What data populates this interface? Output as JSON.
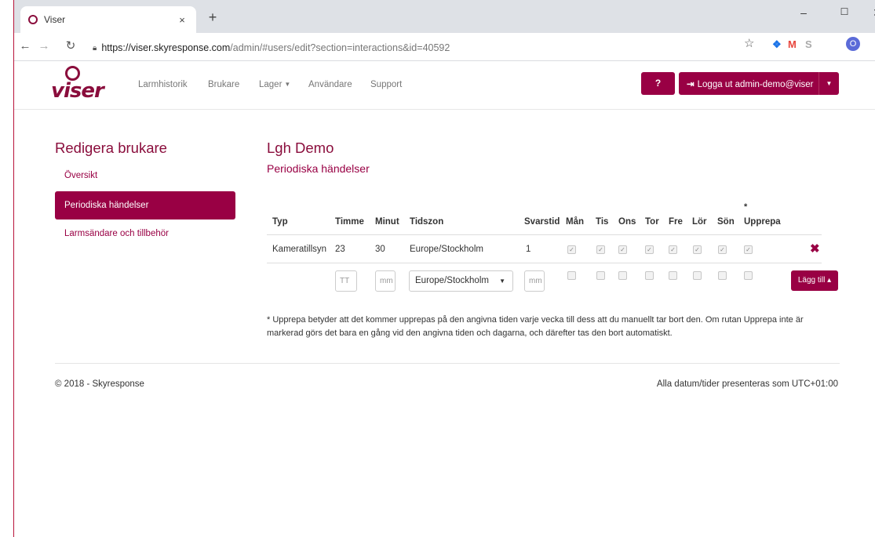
{
  "browser": {
    "tab_title": "Viser",
    "tab_close": "×",
    "new_tab": "+",
    "url_host": "https://viser.skyresponse.com",
    "url_path": "/admin/#users/edit?section=interactions&id=40592",
    "profile_initial": "O",
    "icons": [
      "back-icon",
      "forward-icon",
      "reload-icon",
      "lock-icon",
      "star-icon",
      "minimize-icon",
      "maximize-icon",
      "close-icon"
    ]
  },
  "navbar": {
    "logo_text": "viser",
    "links": {
      "larmhistorik": "Larmhistorik",
      "brukare": "Brukare",
      "lager": "Lager",
      "anvandare": "Användare",
      "support": "Support"
    },
    "help_label": "?",
    "logout_label": "Logga ut admin-demo@viser"
  },
  "sidebar": {
    "title": "Redigera brukare",
    "items": [
      {
        "label": "Översikt",
        "active": false
      },
      {
        "label": "Periodiska händelser",
        "active": true
      },
      {
        "label": "Larmsändare och tillbehör",
        "active": false
      }
    ]
  },
  "main": {
    "title": "Lgh Demo",
    "subtitle": "Periodiska händelser",
    "table": {
      "headers": {
        "typ": "Typ",
        "timme": "Timme",
        "minut": "Minut",
        "tidszon": "Tidszon",
        "svarstid": "Svarstid",
        "man": "Mån",
        "tis": "Tis",
        "ons": "Ons",
        "tor": "Tor",
        "fre": "Fre",
        "lor": "Lör",
        "son": "Sön",
        "upprepa_star": "*",
        "upprepa": "Upprepa"
      },
      "row": {
        "typ": "Kameratillsyn",
        "timme": "23",
        "minut": "30",
        "tidszon": "Europe/Stockholm",
        "svarstid": "1",
        "days_checked": [
          true,
          true,
          true,
          true,
          true,
          true,
          true
        ],
        "upprepa_checked": true
      },
      "new_row": {
        "timme_placeholder": "TT",
        "minut_placeholder": "mm",
        "tidszon_value": "Europe/Stockholm",
        "svarstid_placeholder": "mm",
        "add_label": "Lägg till ▴"
      }
    },
    "footnote": "* Upprepa betyder att det kommer upprepas på den angivna tiden varje vecka till dess att du manuellt tar bort den. Om rutan Upprepa inte är markerad görs det bara en gång vid den angivna tiden och dagarna, och därefter tas den bort automatiskt."
  },
  "footer": {
    "copyright": "© 2018 - Skyresponse",
    "timezone_note": "Alla datum/tider presenteras som UTC+01:00"
  },
  "colors": {
    "brand": "#990044",
    "brand_dark": "#8a0d3c"
  }
}
